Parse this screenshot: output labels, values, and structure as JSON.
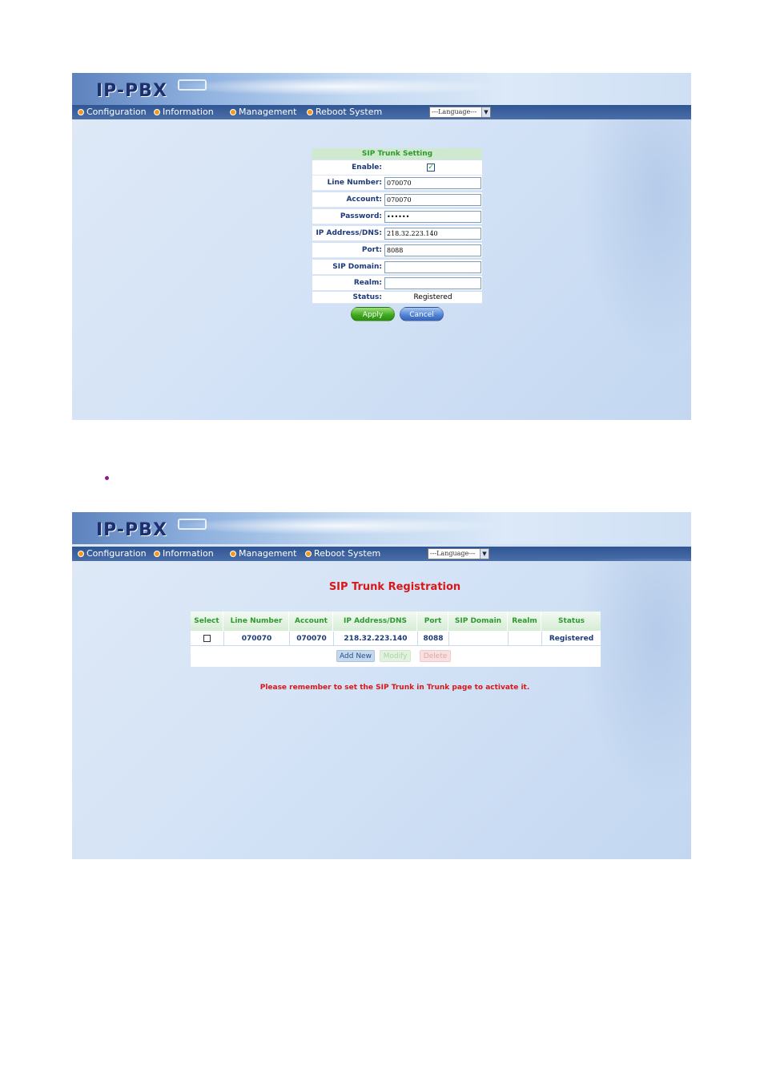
{
  "shared": {
    "logo": "IP-PBX",
    "nav": [
      {
        "label": "Configuration"
      },
      {
        "label": "Information"
      },
      {
        "label": "Management"
      },
      {
        "label": "Reboot System"
      }
    ],
    "language_select": "---Language---"
  },
  "screen1": {
    "form_title": "SIP Trunk Setting",
    "fields": {
      "enable": {
        "label": "Enable:",
        "checked": true
      },
      "line_number": {
        "label": "Line Number:",
        "value": "070070"
      },
      "account": {
        "label": "Account:",
        "value": "070070"
      },
      "password": {
        "label": "Password:",
        "value": "••••••"
      },
      "ip": {
        "label": "IP Address/DNS:",
        "value": "218.32.223.140"
      },
      "port": {
        "label": "Port:",
        "value": "8088"
      },
      "sip_domain": {
        "label": "SIP Domain:",
        "value": ""
      },
      "realm": {
        "label": "Realm:",
        "value": ""
      },
      "status": {
        "label": "Status:",
        "value": "Registered"
      }
    },
    "apply": "Apply",
    "cancel": "Cancel"
  },
  "screen2": {
    "title": "SIP Trunk Registration",
    "columns": [
      "Select",
      "Line Number",
      "Account",
      "IP Address/DNS",
      "Port",
      "SIP Domain",
      "Realm",
      "Status"
    ],
    "rows": [
      {
        "line_number": "070070",
        "account": "070070",
        "ip": "218.32.223.140",
        "port": "8088",
        "sip_domain": "",
        "realm": "",
        "status": "Registered"
      }
    ],
    "add_new": "Add New",
    "modify": "Modify",
    "delete": "Delete",
    "reminder": "Please remember to set the SIP Trunk in Trunk page to activate it."
  },
  "colors": {
    "nav_bg": "#2f5593",
    "title_red": "#d81818",
    "header_green": "#2e9a2e",
    "apply_green": "#3aa61c",
    "cancel_blue": "#4d7fd3"
  }
}
